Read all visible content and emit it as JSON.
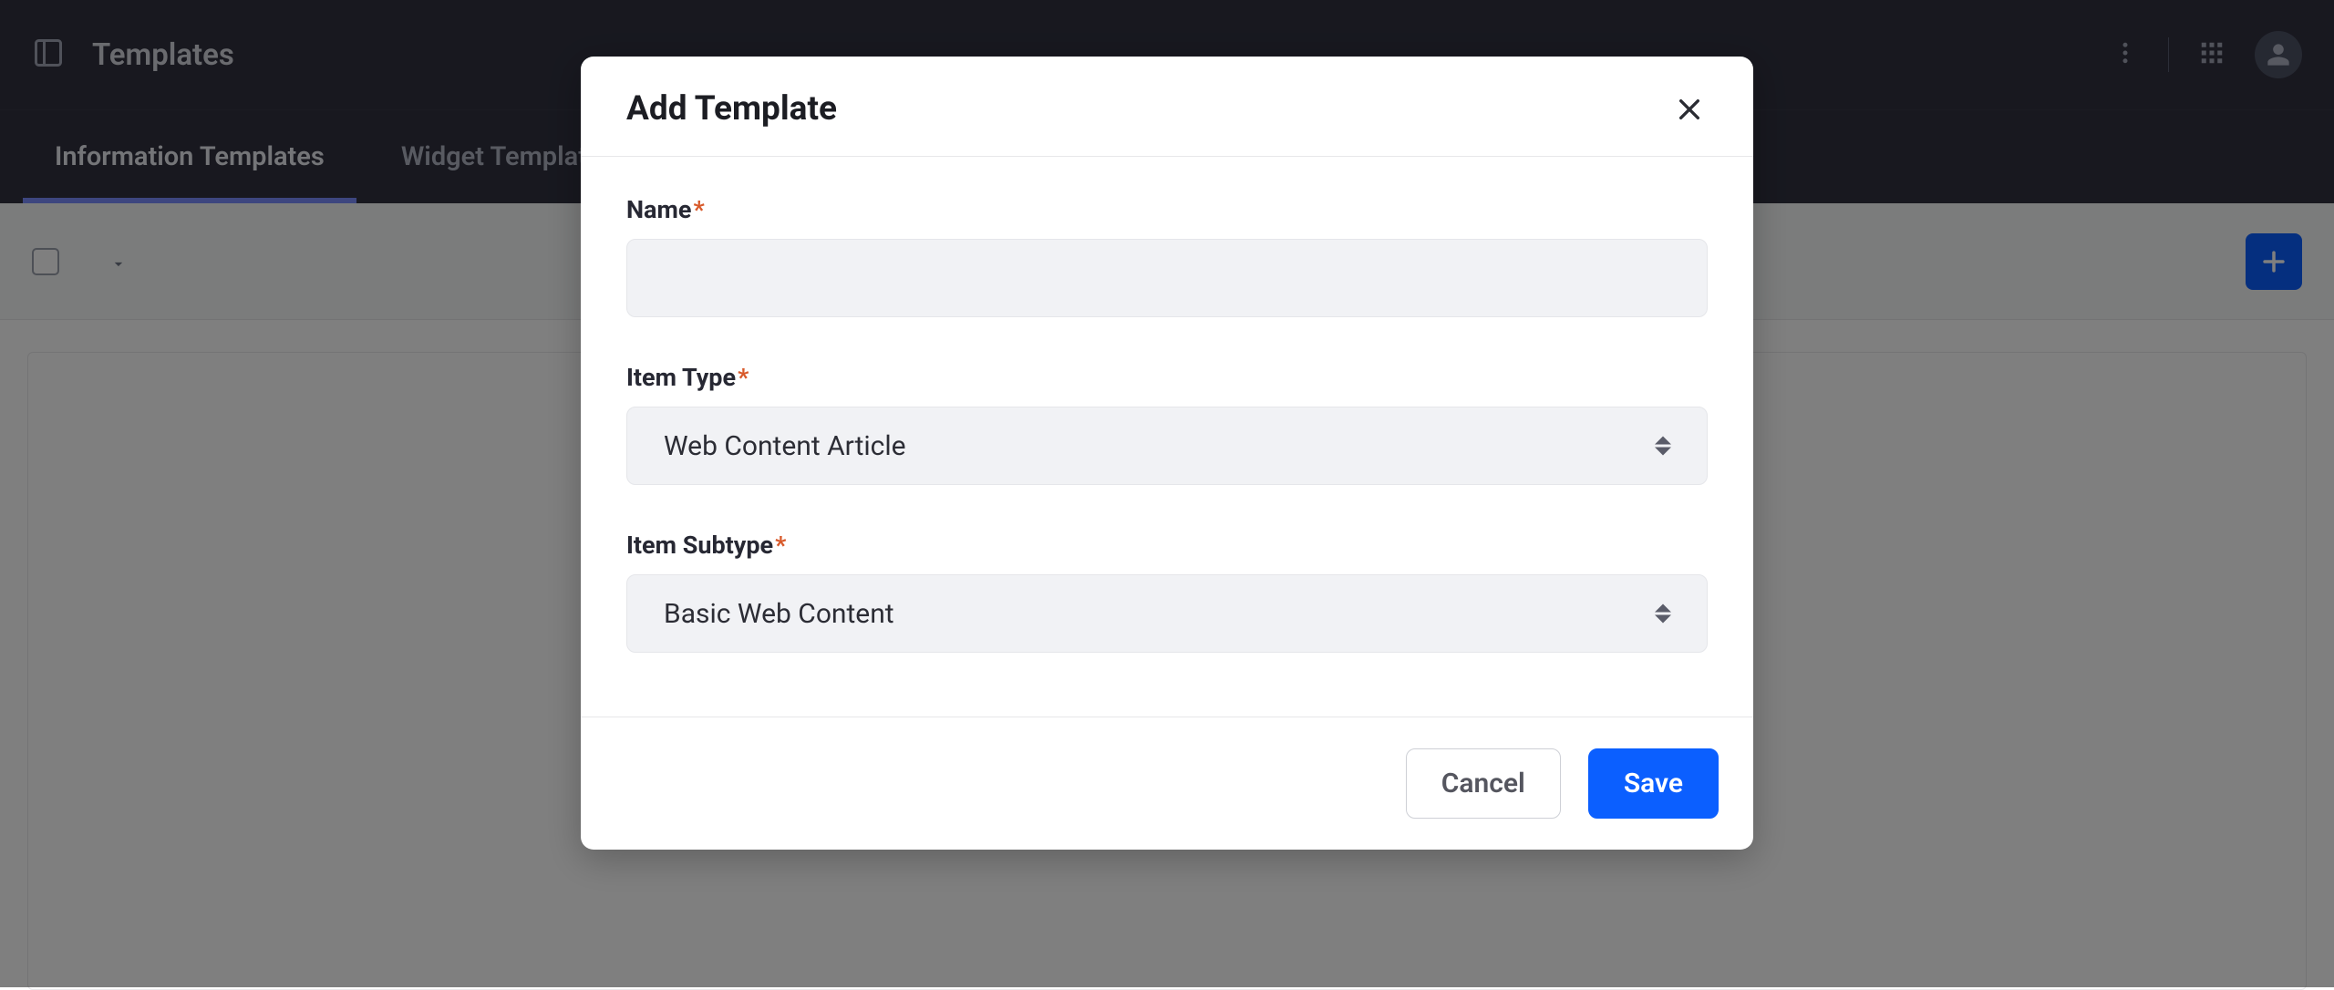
{
  "header": {
    "title": "Templates"
  },
  "tabs": [
    {
      "label": "Information Templates",
      "active": true
    },
    {
      "label": "Widget Templates",
      "active": false
    }
  ],
  "modal": {
    "title": "Add Template",
    "fields": {
      "name": {
        "label": "Name",
        "required": "*",
        "value": ""
      },
      "itemType": {
        "label": "Item Type",
        "required": "*",
        "selected": "Web Content Article"
      },
      "itemSubtype": {
        "label": "Item Subtype",
        "required": "*",
        "selected": "Basic Web Content"
      }
    },
    "buttons": {
      "cancel": "Cancel",
      "save": "Save"
    }
  }
}
